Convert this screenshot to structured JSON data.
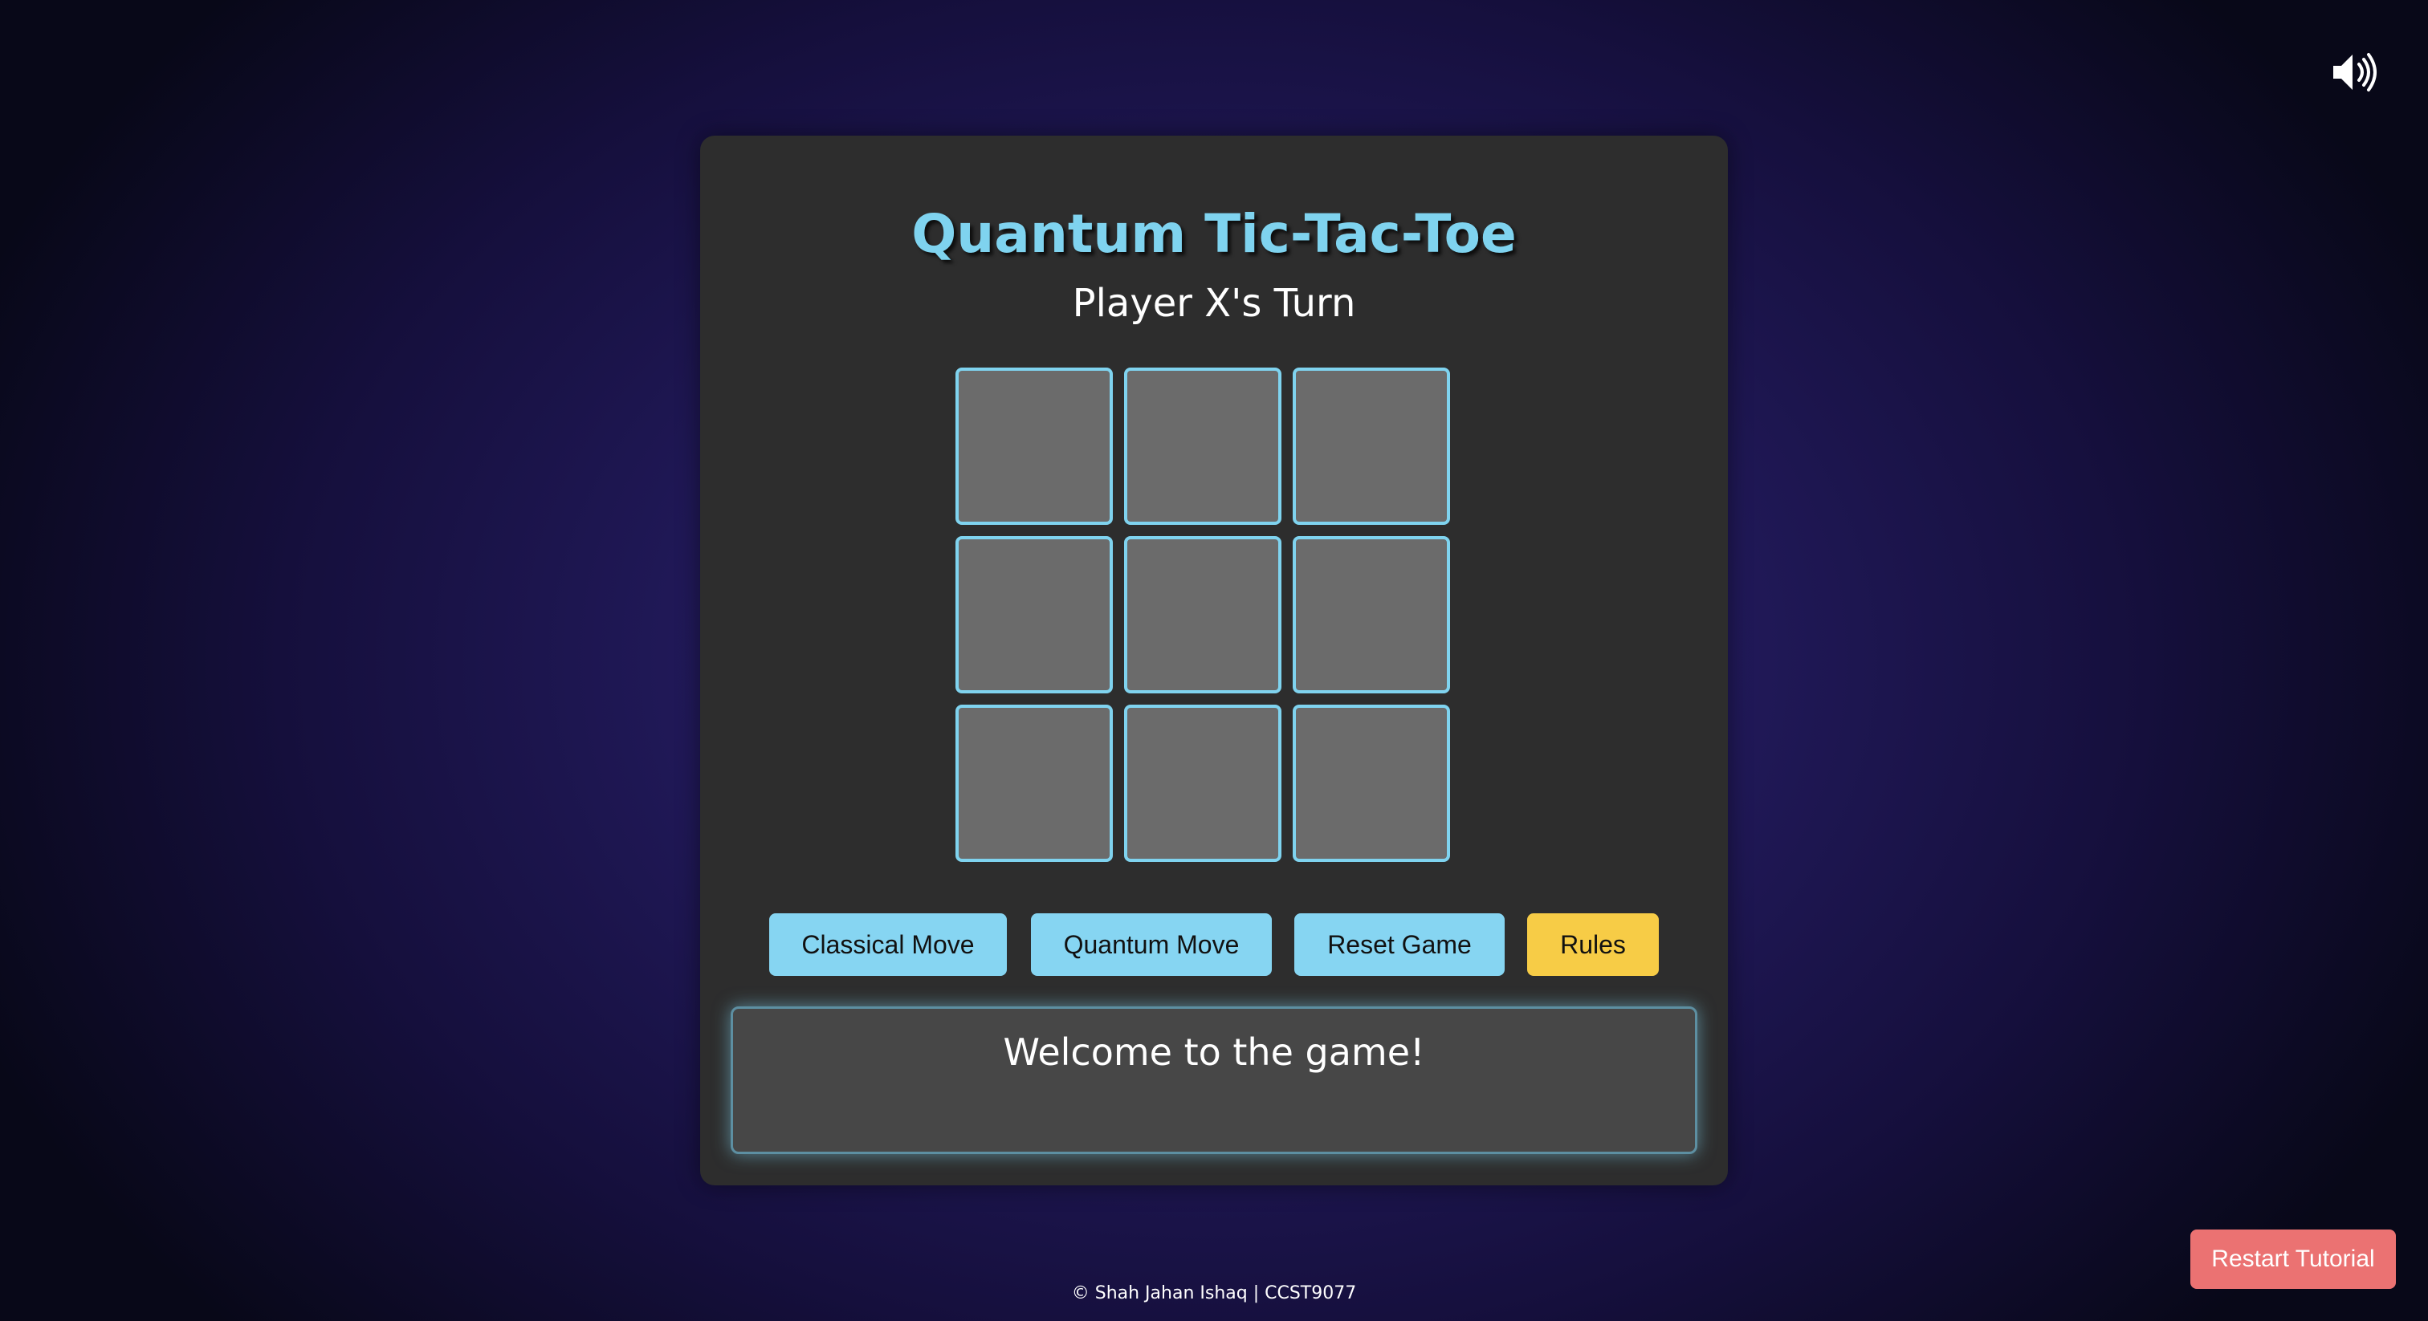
{
  "header": {
    "sound_icon": "speaker-volume-icon"
  },
  "game": {
    "title": "Quantum Tic-Tac-Toe",
    "turn_status": "Player X's Turn",
    "board": {
      "cells": [
        "",
        "",
        "",
        "",
        "",
        "",
        "",
        "",
        ""
      ]
    },
    "controls": {
      "classical_move_label": "Classical Move",
      "quantum_move_label": "Quantum Move",
      "reset_game_label": "Reset Game",
      "rules_label": "Rules"
    },
    "message": "Welcome to the game!"
  },
  "tutorial": {
    "restart_label": "Restart Tutorial"
  },
  "footer": {
    "text": "© Shah Jahan Ishaq | CCST9077"
  },
  "colors": {
    "accent": "#7fd3ef",
    "button_primary": "#86d5f2",
    "button_rules": "#f7cc46",
    "button_restart": "#eb7272",
    "card_background": "#2d2d2d",
    "cell_background": "#6b6b6b"
  }
}
